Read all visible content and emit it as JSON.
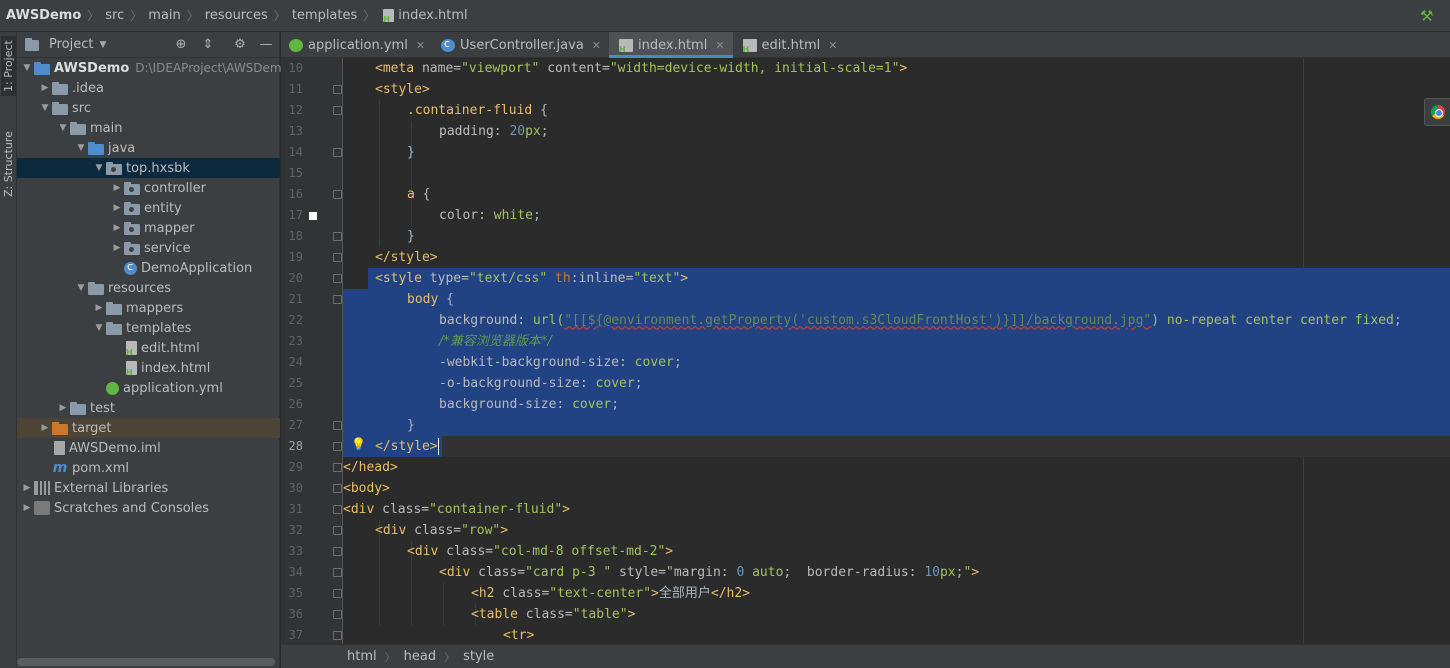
{
  "navbar": {
    "crumbs": [
      "AWSDemo",
      "src",
      "main",
      "resources",
      "templates",
      "index.html"
    ]
  },
  "side_tabs": {
    "project": "1: Project",
    "structure": "Z: Structure"
  },
  "project": {
    "title": "Project",
    "tree": [
      {
        "label": "AWSDemo",
        "hint": "D:\\IDEAProject\\AWSDemo",
        "depth": 0,
        "arrow": "down",
        "icon": "module-folder-icon",
        "bold": true
      },
      {
        "label": ".idea",
        "depth": 1,
        "arrow": "right",
        "icon": "folder-icon"
      },
      {
        "label": "src",
        "depth": 1,
        "arrow": "down",
        "icon": "folder-icon"
      },
      {
        "label": "main",
        "depth": 2,
        "arrow": "down",
        "icon": "folder-icon"
      },
      {
        "label": "java",
        "depth": 3,
        "arrow": "down",
        "icon": "source-folder-icon"
      },
      {
        "label": "top.hxsbk",
        "depth": 4,
        "arrow": "down",
        "icon": "package-icon",
        "selected": true
      },
      {
        "label": "controller",
        "depth": 5,
        "arrow": "right",
        "icon": "package-icon"
      },
      {
        "label": "entity",
        "depth": 5,
        "arrow": "right",
        "icon": "package-icon"
      },
      {
        "label": "mapper",
        "depth": 5,
        "arrow": "right",
        "icon": "package-icon"
      },
      {
        "label": "service",
        "depth": 5,
        "arrow": "right",
        "icon": "package-icon"
      },
      {
        "label": "DemoApplication",
        "depth": 5,
        "arrow": "none",
        "icon": "spring-class-icon"
      },
      {
        "label": "resources",
        "depth": 3,
        "arrow": "down",
        "icon": "resources-folder-icon"
      },
      {
        "label": "mappers",
        "depth": 4,
        "arrow": "right",
        "icon": "folder-icon"
      },
      {
        "label": "templates",
        "depth": 4,
        "arrow": "down",
        "icon": "folder-icon"
      },
      {
        "label": "edit.html",
        "depth": 5,
        "arrow": "none",
        "icon": "html-file-icon"
      },
      {
        "label": "index.html",
        "depth": 5,
        "arrow": "none",
        "icon": "html-file-icon"
      },
      {
        "label": "application.yml",
        "depth": 4,
        "arrow": "none",
        "icon": "yml-file-icon"
      },
      {
        "label": "test",
        "depth": 2,
        "arrow": "right",
        "icon": "folder-icon"
      },
      {
        "label": "target",
        "depth": 1,
        "arrow": "right",
        "icon": "excluded-folder-icon",
        "target": true
      },
      {
        "label": "AWSDemo.iml",
        "depth": 1,
        "arrow": "none",
        "icon": "iml-file-icon"
      },
      {
        "label": "pom.xml",
        "depth": 1,
        "arrow": "none",
        "icon": "maven-icon"
      },
      {
        "label": "External Libraries",
        "depth": 0,
        "arrow": "right",
        "icon": "libraries-icon"
      },
      {
        "label": "Scratches and Consoles",
        "depth": 0,
        "arrow": "right",
        "icon": "scratches-icon"
      }
    ]
  },
  "tabs": [
    {
      "label": "application.yml",
      "icon": "yml-file-icon",
      "active": false
    },
    {
      "label": "UserController.java",
      "icon": "java-class-icon",
      "active": false
    },
    {
      "label": "index.html",
      "icon": "html-file-icon",
      "active": true
    },
    {
      "label": "edit.html",
      "icon": "html-file-icon",
      "active": false
    }
  ],
  "editor": {
    "current_line": 28,
    "lines": [
      {
        "n": 10,
        "indent": 1,
        "code": [
          [
            "tag",
            "<meta "
          ],
          [
            "attr",
            "name="
          ],
          [
            "str",
            "\"viewport\" "
          ],
          [
            "attr",
            "content="
          ],
          [
            "str",
            "\"width=device-width, initial-scale=1\""
          ],
          [
            "tag",
            ">"
          ]
        ]
      },
      {
        "n": 11,
        "indent": 1,
        "code": [
          [
            "tag",
            "<style>"
          ]
        ]
      },
      {
        "n": 12,
        "indent": 2,
        "code": [
          [
            "css-sel",
            ".container-fluid "
          ],
          [
            "plain",
            "{"
          ]
        ]
      },
      {
        "n": 13,
        "indent": 3,
        "code": [
          [
            "prop",
            "padding: "
          ],
          [
            "num",
            "20"
          ],
          [
            "val",
            "px"
          ],
          [
            "plain",
            ";"
          ]
        ]
      },
      {
        "n": 14,
        "indent": 2,
        "code": [
          [
            "plain",
            "}"
          ]
        ]
      },
      {
        "n": 15,
        "indent": 0,
        "code": []
      },
      {
        "n": 16,
        "indent": 2,
        "code": [
          [
            "css-sel",
            "a "
          ],
          [
            "plain",
            "{"
          ]
        ]
      },
      {
        "n": 17,
        "indent": 3,
        "code": [
          [
            "prop",
            "color: "
          ],
          [
            "val",
            "white"
          ],
          [
            "plain",
            ";"
          ]
        ]
      },
      {
        "n": 18,
        "indent": 2,
        "code": [
          [
            "plain",
            "}"
          ]
        ]
      },
      {
        "n": 19,
        "indent": 1,
        "code": [
          [
            "tag",
            "</style>"
          ]
        ]
      },
      {
        "n": 20,
        "indent": 1,
        "code": [
          [
            "tag",
            "<style "
          ],
          [
            "attr",
            "type="
          ],
          [
            "str",
            "\"text/css\" "
          ],
          [
            "thattr",
            "th"
          ],
          [
            "attr",
            ":inline="
          ],
          [
            "str",
            "\"text\""
          ],
          [
            "tag",
            ">"
          ]
        ]
      },
      {
        "n": 21,
        "indent": 2,
        "code": [
          [
            "css-sel",
            "body "
          ],
          [
            "plain",
            "{"
          ]
        ]
      },
      {
        "n": 22,
        "indent": 3,
        "code": [
          [
            "prop",
            "background: "
          ],
          [
            "val",
            "url("
          ],
          [
            "url",
            "\"[[${@environment.getProperty('custom.s3CloudFrontHost')}]]/background.jpg\""
          ],
          [
            "val",
            ") no-repeat center center fixed"
          ],
          [
            "plain",
            ";"
          ]
        ]
      },
      {
        "n": 23,
        "indent": 3,
        "code": [
          [
            "cmt",
            "/*兼容浏览器版本*/"
          ]
        ]
      },
      {
        "n": 24,
        "indent": 3,
        "code": [
          [
            "prop",
            "-webkit-background-size: "
          ],
          [
            "val",
            "cover"
          ],
          [
            "plain",
            ";"
          ]
        ]
      },
      {
        "n": 25,
        "indent": 3,
        "code": [
          [
            "prop",
            "-o-background-size: "
          ],
          [
            "val",
            "cover"
          ],
          [
            "plain",
            ";"
          ]
        ]
      },
      {
        "n": 26,
        "indent": 3,
        "code": [
          [
            "prop",
            "background-size: "
          ],
          [
            "val",
            "cover"
          ],
          [
            "plain",
            ";"
          ]
        ]
      },
      {
        "n": 27,
        "indent": 2,
        "code": [
          [
            "plain",
            "}"
          ]
        ]
      },
      {
        "n": 28,
        "indent": 1,
        "code": [
          [
            "tag",
            "</style>"
          ]
        ]
      },
      {
        "n": 29,
        "indent": 0,
        "code": [
          [
            "tag",
            "</head>"
          ]
        ]
      },
      {
        "n": 30,
        "indent": 0,
        "code": [
          [
            "tag",
            "<body>"
          ]
        ]
      },
      {
        "n": 31,
        "indent": 0,
        "code": [
          [
            "tag",
            "<div "
          ],
          [
            "attr",
            "class="
          ],
          [
            "str",
            "\"container-fluid\""
          ],
          [
            "tag",
            ">"
          ]
        ]
      },
      {
        "n": 32,
        "indent": 1,
        "code": [
          [
            "tag",
            "<div "
          ],
          [
            "attr",
            "class="
          ],
          [
            "str",
            "\"row\""
          ],
          [
            "tag",
            ">"
          ]
        ]
      },
      {
        "n": 33,
        "indent": 2,
        "code": [
          [
            "tag",
            "<div "
          ],
          [
            "attr",
            "class="
          ],
          [
            "str",
            "\"col-md-8 offset-md-2\""
          ],
          [
            "tag",
            ">"
          ]
        ]
      },
      {
        "n": 34,
        "indent": 3,
        "code": [
          [
            "tag",
            "<div "
          ],
          [
            "attr",
            "class="
          ],
          [
            "str",
            "\"card p-3 \" "
          ],
          [
            "attr",
            "style="
          ],
          [
            "str",
            "\""
          ],
          [
            "prop",
            "margin: "
          ],
          [
            "num",
            "0 "
          ],
          [
            "val",
            "auto"
          ],
          [
            "plain",
            ";  "
          ],
          [
            "prop",
            "border-radius: "
          ],
          [
            "num",
            "10"
          ],
          [
            "val",
            "px"
          ],
          [
            "plain",
            ";"
          ],
          [
            "str",
            "\""
          ],
          [
            "tag",
            ">"
          ]
        ]
      },
      {
        "n": 35,
        "indent": 4,
        "code": [
          [
            "tag",
            "<h2 "
          ],
          [
            "attr",
            "class="
          ],
          [
            "str",
            "\"text-center\""
          ],
          [
            "tag",
            ">"
          ],
          [
            "plain",
            "全部用户"
          ],
          [
            "tag",
            "</h2>"
          ]
        ]
      },
      {
        "n": 36,
        "indent": 4,
        "code": [
          [
            "tag",
            "<table "
          ],
          [
            "attr",
            "class="
          ],
          [
            "str",
            "\"table\""
          ],
          [
            "tag",
            ">"
          ]
        ]
      },
      {
        "n": 37,
        "indent": 5,
        "code": [
          [
            "tag",
            "<tr>"
          ]
        ]
      }
    ]
  },
  "bottom_crumbs": [
    "html",
    "head",
    "style"
  ]
}
